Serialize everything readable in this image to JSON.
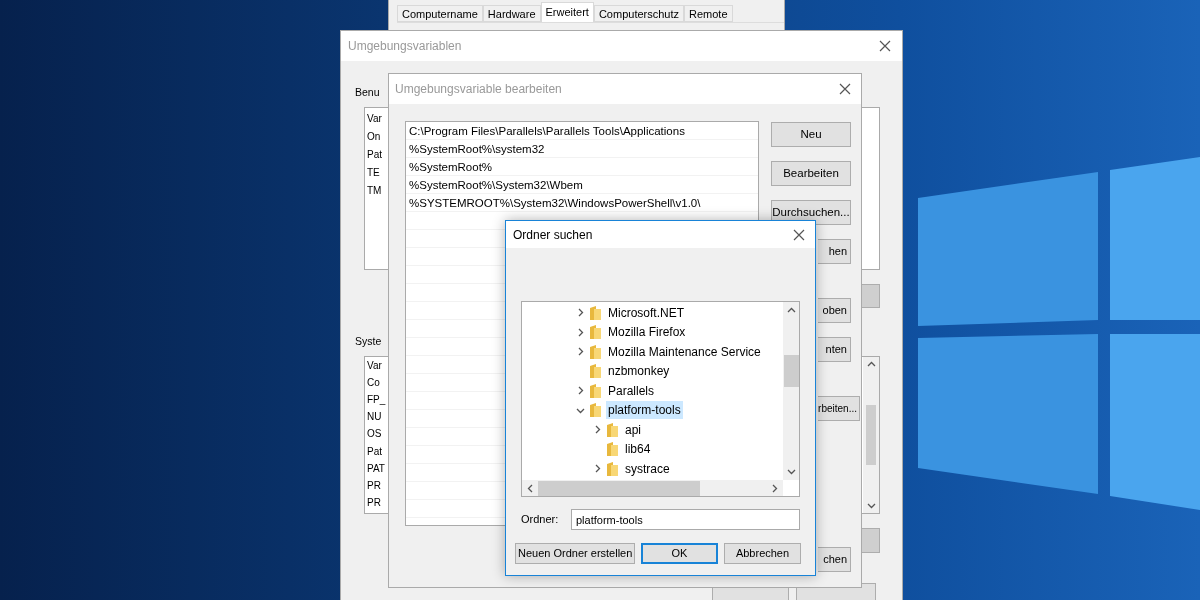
{
  "system_properties": {
    "tabs": [
      {
        "label": "Computername",
        "selected": false
      },
      {
        "label": "Hardware",
        "selected": false
      },
      {
        "label": "Erweitert",
        "selected": true
      },
      {
        "label": "Computerschutz",
        "selected": false
      },
      {
        "label": "Remote",
        "selected": false
      }
    ]
  },
  "env_window": {
    "title": "Umgebungsvariablen",
    "user_section_label": "Benu",
    "user_vars": [
      "Var",
      "On",
      "Pat",
      "TE",
      "TM"
    ],
    "system_section_label": "Syste",
    "system_vars": [
      "Var",
      "Co",
      "FP_",
      "NU",
      "OS",
      "Pat",
      "PAT",
      "PR",
      "PR"
    ]
  },
  "edit_dialog": {
    "title": "Umgebungsvariable bearbeiten",
    "entries": [
      "C:\\Program Files\\Parallels\\Parallels Tools\\Applications",
      "%SystemRoot%\\system32",
      "%SystemRoot%",
      "%SystemRoot%\\System32\\Wbem",
      "%SYSTEMROOT%\\System32\\WindowsPowerShell\\v1.0\\"
    ],
    "buttons": [
      "Neu",
      "Bearbeiten",
      "Durchsuchen...",
      "hen",
      "oben",
      "nten",
      "rbeiten...",
      "chen"
    ]
  },
  "folder_dialog": {
    "title": "Ordner suchen",
    "tree": [
      {
        "label": "Microsoft.NET",
        "expandable": true,
        "expanded": false,
        "selected": false
      },
      {
        "label": "Mozilla Firefox",
        "expandable": true,
        "expanded": false,
        "selected": false
      },
      {
        "label": "Mozilla Maintenance Service",
        "expandable": true,
        "expanded": false,
        "selected": false
      },
      {
        "label": "nzbmonkey",
        "expandable": false,
        "selected": false
      },
      {
        "label": "Parallels",
        "expandable": true,
        "expanded": false,
        "selected": false
      },
      {
        "label": "platform-tools",
        "expandable": true,
        "expanded": true,
        "selected": true,
        "children": [
          {
            "label": "api",
            "expandable": true,
            "expanded": false,
            "selected": false
          },
          {
            "label": "lib64",
            "expandable": false,
            "selected": false
          },
          {
            "label": "systrace",
            "expandable": true,
            "expanded": false,
            "selected": false
          }
        ]
      }
    ],
    "folder_label": "Ordner:",
    "folder_value": "platform-tools",
    "buttons": [
      {
        "label": "Neuen Ordner erstellen",
        "default": false
      },
      {
        "label": "OK",
        "default": true
      },
      {
        "label": "Abbrechen",
        "default": false
      }
    ]
  }
}
